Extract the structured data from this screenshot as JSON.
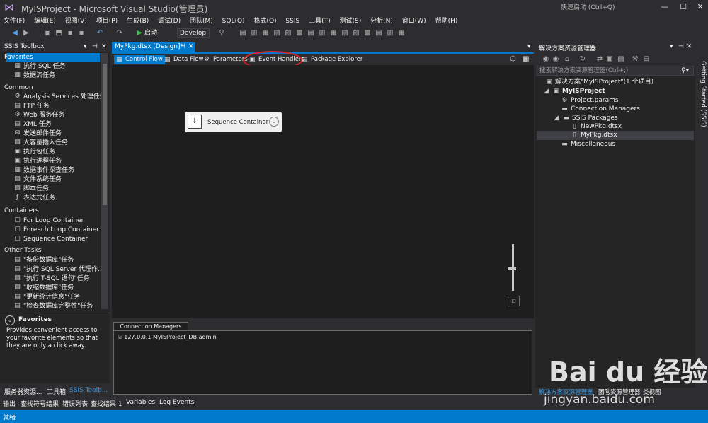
{
  "window": {
    "title": "MyISProject - Microsoft Visual Studio(管理员)",
    "quick_launch": "快速启动 (Ctrl+Q)"
  },
  "menu": [
    "文件(F)",
    "编辑(E)",
    "视图(V)",
    "项目(P)",
    "生成(B)",
    "调试(D)",
    "团队(M)",
    "SQL(Q)",
    "格式(O)",
    "SSIS",
    "工具(T)",
    "测试(S)",
    "分析(N)",
    "窗口(W)",
    "帮助(H)"
  ],
  "toolbar": {
    "start_label": "启动",
    "config_value": "Develop"
  },
  "toolbox": {
    "title": "SSIS Toolbox",
    "sections": {
      "favorites": "Favorites",
      "common": "Common",
      "containers": "Containers",
      "other": "Other Tasks"
    },
    "favorites_items": [
      "执行 SQL 任务",
      "数据流任务"
    ],
    "common_items": [
      "Analysis Services 处理任务",
      "FTP 任务",
      "Web 服务任务",
      "XML 任务",
      "发送邮件任务",
      "大容量插入任务",
      "执行包任务",
      "执行进程任务",
      "数据事件探查任务",
      "文件系统任务",
      "脚本任务",
      "表达式任务"
    ],
    "container_items": [
      "For Loop Container",
      "Foreach Loop Container",
      "Sequence Container"
    ],
    "other_items": [
      "\"备份数据库\"任务",
      "\"执行 SQL Server 代理作...",
      "\"执行 T-SQL 语句\"任务",
      "\"收缩数据库\"任务",
      "\"更新统计信息\"任务",
      "\"检查数据库完整性\"任务"
    ],
    "description": {
      "title": "Favorites",
      "text": "Provides convenient access to your favorite elements so that they are only a click away."
    },
    "bottom_tabs": [
      "服务器资源...",
      "工具箱",
      "SSIS Toolb..."
    ]
  },
  "document": {
    "tab_label": "MyPkg.dtsx [Design]*",
    "designer_tabs": [
      "Control Flow",
      "Data Flow",
      "Parameters",
      "Event Handlers",
      "Package Explorer"
    ],
    "sequence_container_label": "Sequence Container",
    "connection_managers_tab": "Connection Managers",
    "connection_item": "127.0.0.1.MyISProject_DB.admin"
  },
  "solution_explorer": {
    "title": "解决方案资源管理器",
    "search_placeholder": "搜索解决方案资源管理器(Ctrl+;)",
    "tree": [
      "解决方案\"MyISProject\"(1 个项目)",
      "MyISProject",
      "Project.params",
      "Connection Managers",
      "SSIS Packages",
      "NewPkg.dtsx",
      "MyPkg.dtsx",
      "Miscellaneous"
    ],
    "bottom_tabs": [
      "解决方案资源管理器",
      "团队资源管理器",
      "类视图"
    ],
    "side_label": "Getting Started (SSIS)"
  },
  "output_tabs": [
    "输出",
    "查找符号结果",
    "错误列表",
    "查找结果 1",
    "Variables",
    "Log Events"
  ],
  "status": "就绪",
  "watermark": {
    "logo": "Bai du 经验",
    "url": "jingyan.baidu.com"
  }
}
